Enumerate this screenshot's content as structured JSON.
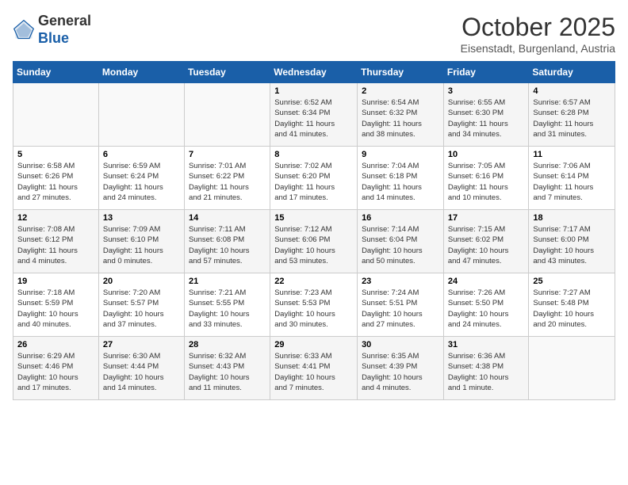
{
  "header": {
    "logo_line1": "General",
    "logo_line2": "Blue",
    "title": "October 2025",
    "subtitle": "Eisenstadt, Burgenland, Austria"
  },
  "weekdays": [
    "Sunday",
    "Monday",
    "Tuesday",
    "Wednesday",
    "Thursday",
    "Friday",
    "Saturday"
  ],
  "weeks": [
    [
      {
        "day": "",
        "info": ""
      },
      {
        "day": "",
        "info": ""
      },
      {
        "day": "",
        "info": ""
      },
      {
        "day": "1",
        "info": "Sunrise: 6:52 AM\nSunset: 6:34 PM\nDaylight: 11 hours\nand 41 minutes."
      },
      {
        "day": "2",
        "info": "Sunrise: 6:54 AM\nSunset: 6:32 PM\nDaylight: 11 hours\nand 38 minutes."
      },
      {
        "day": "3",
        "info": "Sunrise: 6:55 AM\nSunset: 6:30 PM\nDaylight: 11 hours\nand 34 minutes."
      },
      {
        "day": "4",
        "info": "Sunrise: 6:57 AM\nSunset: 6:28 PM\nDaylight: 11 hours\nand 31 minutes."
      }
    ],
    [
      {
        "day": "5",
        "info": "Sunrise: 6:58 AM\nSunset: 6:26 PM\nDaylight: 11 hours\nand 27 minutes."
      },
      {
        "day": "6",
        "info": "Sunrise: 6:59 AM\nSunset: 6:24 PM\nDaylight: 11 hours\nand 24 minutes."
      },
      {
        "day": "7",
        "info": "Sunrise: 7:01 AM\nSunset: 6:22 PM\nDaylight: 11 hours\nand 21 minutes."
      },
      {
        "day": "8",
        "info": "Sunrise: 7:02 AM\nSunset: 6:20 PM\nDaylight: 11 hours\nand 17 minutes."
      },
      {
        "day": "9",
        "info": "Sunrise: 7:04 AM\nSunset: 6:18 PM\nDaylight: 11 hours\nand 14 minutes."
      },
      {
        "day": "10",
        "info": "Sunrise: 7:05 AM\nSunset: 6:16 PM\nDaylight: 11 hours\nand 10 minutes."
      },
      {
        "day": "11",
        "info": "Sunrise: 7:06 AM\nSunset: 6:14 PM\nDaylight: 11 hours\nand 7 minutes."
      }
    ],
    [
      {
        "day": "12",
        "info": "Sunrise: 7:08 AM\nSunset: 6:12 PM\nDaylight: 11 hours\nand 4 minutes."
      },
      {
        "day": "13",
        "info": "Sunrise: 7:09 AM\nSunset: 6:10 PM\nDaylight: 11 hours\nand 0 minutes."
      },
      {
        "day": "14",
        "info": "Sunrise: 7:11 AM\nSunset: 6:08 PM\nDaylight: 10 hours\nand 57 minutes."
      },
      {
        "day": "15",
        "info": "Sunrise: 7:12 AM\nSunset: 6:06 PM\nDaylight: 10 hours\nand 53 minutes."
      },
      {
        "day": "16",
        "info": "Sunrise: 7:14 AM\nSunset: 6:04 PM\nDaylight: 10 hours\nand 50 minutes."
      },
      {
        "day": "17",
        "info": "Sunrise: 7:15 AM\nSunset: 6:02 PM\nDaylight: 10 hours\nand 47 minutes."
      },
      {
        "day": "18",
        "info": "Sunrise: 7:17 AM\nSunset: 6:00 PM\nDaylight: 10 hours\nand 43 minutes."
      }
    ],
    [
      {
        "day": "19",
        "info": "Sunrise: 7:18 AM\nSunset: 5:59 PM\nDaylight: 10 hours\nand 40 minutes."
      },
      {
        "day": "20",
        "info": "Sunrise: 7:20 AM\nSunset: 5:57 PM\nDaylight: 10 hours\nand 37 minutes."
      },
      {
        "day": "21",
        "info": "Sunrise: 7:21 AM\nSunset: 5:55 PM\nDaylight: 10 hours\nand 33 minutes."
      },
      {
        "day": "22",
        "info": "Sunrise: 7:23 AM\nSunset: 5:53 PM\nDaylight: 10 hours\nand 30 minutes."
      },
      {
        "day": "23",
        "info": "Sunrise: 7:24 AM\nSunset: 5:51 PM\nDaylight: 10 hours\nand 27 minutes."
      },
      {
        "day": "24",
        "info": "Sunrise: 7:26 AM\nSunset: 5:50 PM\nDaylight: 10 hours\nand 24 minutes."
      },
      {
        "day": "25",
        "info": "Sunrise: 7:27 AM\nSunset: 5:48 PM\nDaylight: 10 hours\nand 20 minutes."
      }
    ],
    [
      {
        "day": "26",
        "info": "Sunrise: 6:29 AM\nSunset: 4:46 PM\nDaylight: 10 hours\nand 17 minutes."
      },
      {
        "day": "27",
        "info": "Sunrise: 6:30 AM\nSunset: 4:44 PM\nDaylight: 10 hours\nand 14 minutes."
      },
      {
        "day": "28",
        "info": "Sunrise: 6:32 AM\nSunset: 4:43 PM\nDaylight: 10 hours\nand 11 minutes."
      },
      {
        "day": "29",
        "info": "Sunrise: 6:33 AM\nSunset: 4:41 PM\nDaylight: 10 hours\nand 7 minutes."
      },
      {
        "day": "30",
        "info": "Sunrise: 6:35 AM\nSunset: 4:39 PM\nDaylight: 10 hours\nand 4 minutes."
      },
      {
        "day": "31",
        "info": "Sunrise: 6:36 AM\nSunset: 4:38 PM\nDaylight: 10 hours\nand 1 minute."
      },
      {
        "day": "",
        "info": ""
      }
    ]
  ]
}
